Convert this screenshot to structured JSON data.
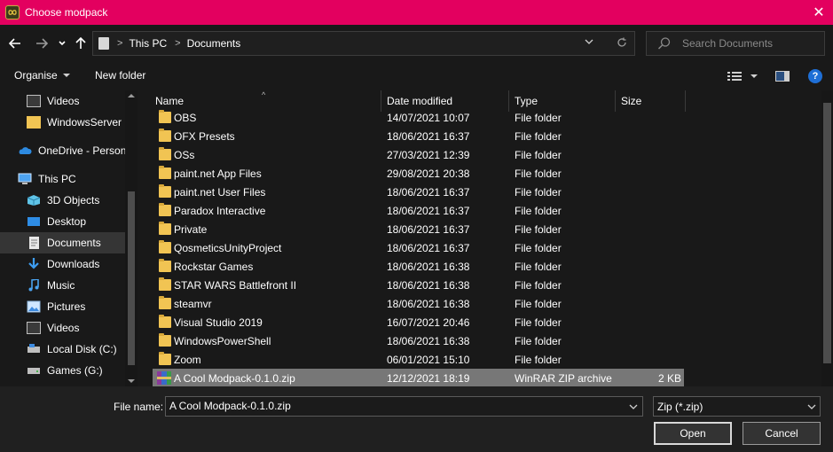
{
  "window": {
    "title": "Choose modpack",
    "close_glyph": "✕"
  },
  "nav": {
    "breadcrumb": [
      "This PC",
      "Documents"
    ],
    "search_placeholder": "Search Documents"
  },
  "toolbar": {
    "organise_label": "Organise",
    "new_folder_label": "New folder"
  },
  "sidebar": {
    "items": [
      {
        "label": "Videos",
        "icon": "video-icon"
      },
      {
        "label": "WindowsServer",
        "icon": "folder-icon"
      },
      {
        "label": "OneDrive - Person",
        "icon": "cloud-icon"
      },
      {
        "label": "This PC",
        "icon": "computer-icon"
      },
      {
        "label": "3D Objects",
        "icon": "cube-icon"
      },
      {
        "label": "Desktop",
        "icon": "desktop-icon"
      },
      {
        "label": "Documents",
        "icon": "documents-icon",
        "selected": true
      },
      {
        "label": "Downloads",
        "icon": "download-icon"
      },
      {
        "label": "Music",
        "icon": "music-icon"
      },
      {
        "label": "Pictures",
        "icon": "pictures-icon"
      },
      {
        "label": "Videos",
        "icon": "video-icon"
      },
      {
        "label": "Local Disk (C:)",
        "icon": "drive-icon"
      },
      {
        "label": "Games (G:)",
        "icon": "drive-icon"
      }
    ]
  },
  "columns": {
    "name": "Name",
    "date": "Date modified",
    "type": "Type",
    "size": "Size"
  },
  "files": [
    {
      "name": "OBS",
      "date": "14/07/2021 10:07",
      "type": "File folder",
      "size": ""
    },
    {
      "name": "OFX Presets",
      "date": "18/06/2021 16:37",
      "type": "File folder",
      "size": ""
    },
    {
      "name": "OSs",
      "date": "27/03/2021 12:39",
      "type": "File folder",
      "size": ""
    },
    {
      "name": "paint.net App Files",
      "date": "29/08/2021 20:38",
      "type": "File folder",
      "size": ""
    },
    {
      "name": "paint.net User Files",
      "date": "18/06/2021 16:37",
      "type": "File folder",
      "size": ""
    },
    {
      "name": "Paradox Interactive",
      "date": "18/06/2021 16:37",
      "type": "File folder",
      "size": ""
    },
    {
      "name": "Private",
      "date": "18/06/2021 16:37",
      "type": "File folder",
      "size": ""
    },
    {
      "name": "QosmeticsUnityProject",
      "date": "18/06/2021 16:37",
      "type": "File folder",
      "size": ""
    },
    {
      "name": "Rockstar Games",
      "date": "18/06/2021 16:38",
      "type": "File folder",
      "size": ""
    },
    {
      "name": "STAR WARS Battlefront II",
      "date": "18/06/2021 16:38",
      "type": "File folder",
      "size": ""
    },
    {
      "name": "steamvr",
      "date": "18/06/2021 16:38",
      "type": "File folder",
      "size": ""
    },
    {
      "name": "Visual Studio 2019",
      "date": "16/07/2021 20:46",
      "type": "File folder",
      "size": ""
    },
    {
      "name": "WindowsPowerShell",
      "date": "18/06/2021 16:38",
      "type": "File folder",
      "size": ""
    },
    {
      "name": "Zoom",
      "date": "06/01/2021 15:10",
      "type": "File folder",
      "size": ""
    },
    {
      "name": "A Cool Modpack-0.1.0.zip",
      "date": "12/12/2021 18:19",
      "type": "WinRAR ZIP archive",
      "size": "2 KB",
      "selected": true
    }
  ],
  "footer": {
    "file_name_label": "File name:",
    "file_name_value": "A Cool Modpack-0.1.0.zip",
    "file_type_value": "Zip (*.zip)",
    "open_label": "Open",
    "cancel_label": "Cancel"
  },
  "colors": {
    "titlebar": "#e3005f",
    "selected_row": "#777777"
  }
}
